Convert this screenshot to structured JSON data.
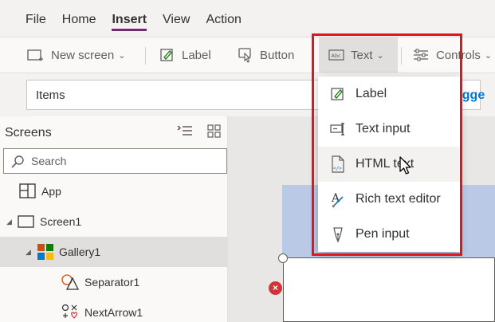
{
  "menu": {
    "items": [
      {
        "label": "File",
        "active": false
      },
      {
        "label": "Home",
        "active": false
      },
      {
        "label": "Insert",
        "active": true
      },
      {
        "label": "View",
        "active": false
      },
      {
        "label": "Action",
        "active": false
      }
    ]
  },
  "ribbon": {
    "new_screen": "New screen",
    "label": "Label",
    "button": "Button",
    "text": "Text",
    "controls": "Controls"
  },
  "formula": {
    "property": "Items",
    "suggest_fragment": "ugge"
  },
  "tree": {
    "title": "Screens",
    "search_placeholder": "Search",
    "nodes": [
      {
        "label": "App"
      },
      {
        "label": "Screen1"
      },
      {
        "label": "Gallery1"
      },
      {
        "label": "Separator1"
      },
      {
        "label": "NextArrow1"
      }
    ]
  },
  "text_menu": {
    "items": [
      {
        "label": "Label",
        "icon": "label-edit-icon"
      },
      {
        "label": "Text input",
        "icon": "text-input-icon"
      },
      {
        "label": "HTML text",
        "icon": "html-text-icon"
      },
      {
        "label": "Rich text editor",
        "icon": "rich-text-icon"
      },
      {
        "label": "Pen input",
        "icon": "pen-input-icon"
      }
    ]
  },
  "colors": {
    "accent": "#742774",
    "highlight": "#e3141b",
    "error": "#d13438",
    "link": "#0078d4"
  }
}
